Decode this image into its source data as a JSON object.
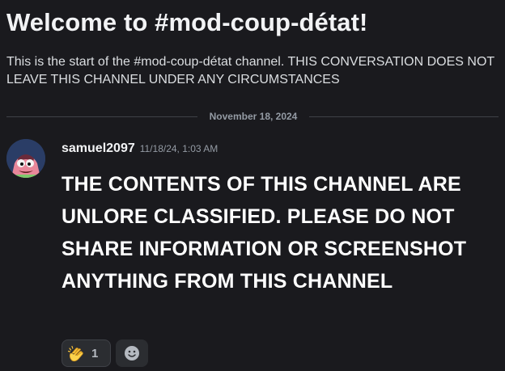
{
  "channel": {
    "welcome_title": "Welcome to #mod-coup-détat!",
    "intro_text": "This is the start of the #mod-coup-détat channel. THIS CONVERSATION DOES NOT LEAVE THIS CHANNEL UNDER ANY CIRCUMSTANCES"
  },
  "divider": {
    "date": "November 18, 2024"
  },
  "message": {
    "username": "samuel2097",
    "timestamp": "11/18/24, 1:03 AM",
    "avatar_icon": "patrick-star-avatar",
    "content": "THE CONTENTS OF THIS CHANNEL ARE UNLORE CLASSIFIED. PLEASE DO NOT SHARE INFORMATION OR SCREENSHOT ANYTHING FROM THIS CHANNEL"
  },
  "reactions": [
    {
      "icon": "clapping-hands-icon",
      "count": "1"
    }
  ],
  "add_reaction_icon": "add-reaction-smiley-icon",
  "colors": {
    "background": "#1a1a1e",
    "text_primary": "#f2f3f5",
    "text_muted": "#949ba4",
    "reaction_bg": "#2b2d31",
    "divider": "#3f4147"
  }
}
